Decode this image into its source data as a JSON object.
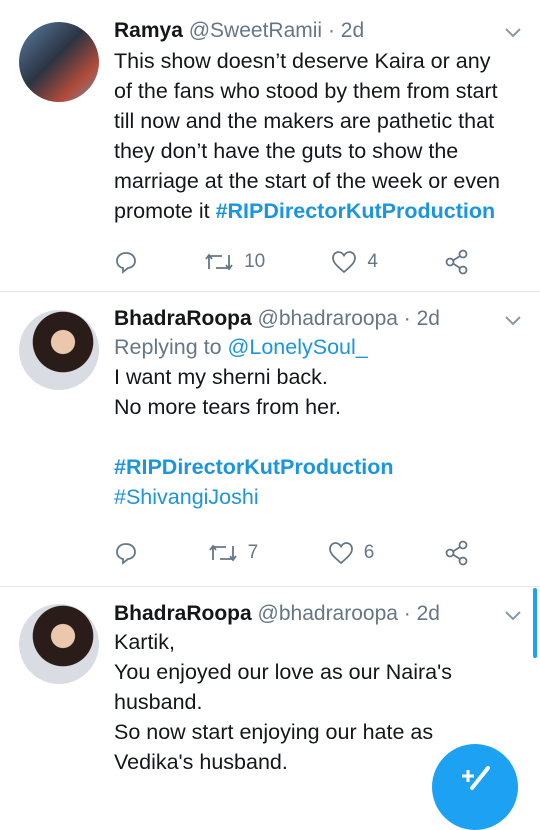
{
  "tweets": [
    {
      "name": "Ramya",
      "handle": "@SweetRamii",
      "time": "· 2d",
      "text": "This show doesn’t deserve Kaira or any of the fans who stood by them from start till now and the makers are pathetic that they don’t have the guts to show the marriage at the start of the week or even promote it ",
      "hashtags": [
        "#RIPDirectorKutProduction"
      ],
      "retweets": "10",
      "likes": "4"
    },
    {
      "name": "BhadraRoopa",
      "handle": "@bhadraroopa",
      "time": "· 2d",
      "replying_label": "Replying to ",
      "replying_to": "@LonelySoul_",
      "lines": [
        "I want my sherni back.",
        "No more tears from her."
      ],
      "hashtags": [
        "#RIPDirectorKutProduction",
        "#ShivangiJoshi"
      ],
      "retweets": "7",
      "likes": "6"
    },
    {
      "name": "BhadraRoopa",
      "handle": "@bhadraroopa",
      "time": "· 2d",
      "lines": [
        "Kartik,",
        "You enjoyed our love as our Naira's husband.",
        "So now start enjoying our hate as Vedika's husband."
      ]
    }
  ],
  "icons": {
    "reply": "reply-icon",
    "retweet": "retweet-icon",
    "like": "heart-icon",
    "share": "share-icon",
    "caret": "chevron-down-icon",
    "compose": "compose-icon"
  },
  "colors": {
    "accent": "#1da1f2",
    "link": "#1b95e0",
    "muted": "#657786"
  }
}
